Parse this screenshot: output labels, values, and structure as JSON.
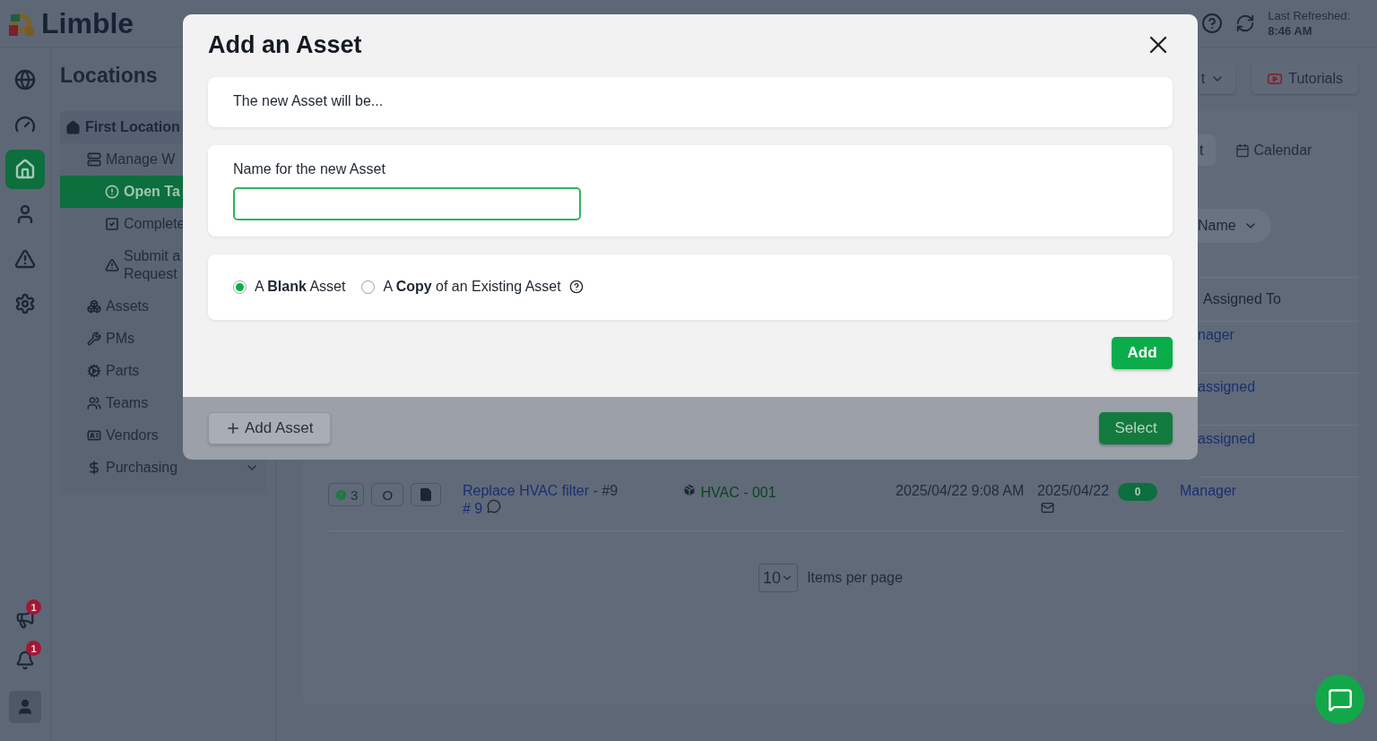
{
  "header": {
    "logo": "Limble",
    "refresh_label": "Last Refreshed:",
    "refresh_time": "8:46 AM"
  },
  "rail": {
    "items": [
      {
        "selected": false
      },
      {
        "selected": false
      },
      {
        "selected": true
      },
      {
        "selected": false
      },
      {
        "selected": false
      },
      {
        "selected": false
      }
    ],
    "alerts": [
      {
        "count": "1"
      },
      {
        "count": "1"
      }
    ]
  },
  "nav": {
    "title": "Locations",
    "location": "First Location",
    "items": [
      {
        "label": "Manage W",
        "selected": false,
        "children": [
          {
            "label": "Open Ta",
            "selected": true
          },
          {
            "label": "Complete",
            "selected": false
          },
          {
            "label": "Submit a Request",
            "selected": false
          }
        ]
      },
      {
        "label": "Assets",
        "selected": false
      },
      {
        "label": "PMs",
        "selected": false
      },
      {
        "label": "Parts",
        "selected": false
      },
      {
        "label": "Teams",
        "selected": false
      },
      {
        "label": "Vendors",
        "selected": false
      },
      {
        "label": "Purchasing",
        "selected": false,
        "expandable": true
      }
    ]
  },
  "toolbar": {
    "dropdown_fragment": "t",
    "tutorials": "Tutorials"
  },
  "list": {
    "tab_fragment": "t",
    "calendar": "Calendar",
    "sort": "Name",
    "column_header": "Assigned To",
    "partial_rows": [
      "nager",
      "assigned",
      "assigned"
    ],
    "row": {
      "count": "3",
      "status": "O",
      "title": "Replace HVAC filter -",
      "number": "#9",
      "ref": "# 9",
      "asset": "HVAC - 001",
      "created": "2025/04/22 9:08 AM",
      "due": "2025/04/22",
      "due_badge": "0",
      "assigned": "Manager"
    },
    "per_page": "10",
    "per_page_label": "Items per page"
  },
  "behind_dialog": {
    "add_button": "Add Asset",
    "select_button": "Select"
  },
  "dialog": {
    "title": "Add an Asset",
    "intro": "The new Asset will be...",
    "name_label": "Name for the new Asset",
    "options": [
      {
        "label": "A **Blank** Asset",
        "selected": true,
        "help": false
      },
      {
        "label": "A **Copy** of an Existing Asset",
        "selected": false,
        "help": true
      }
    ],
    "add_button": "Add"
  }
}
